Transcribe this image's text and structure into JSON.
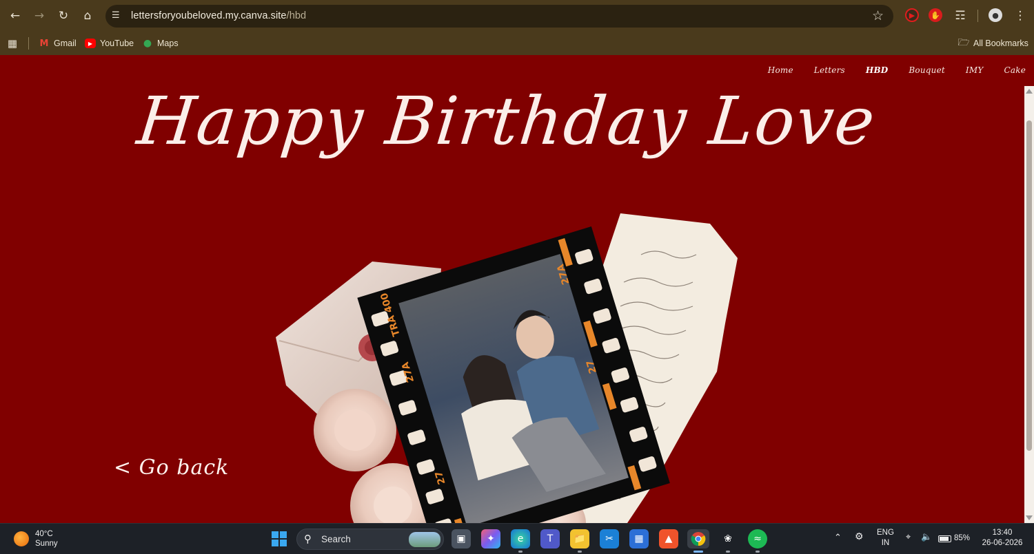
{
  "browser": {
    "url_host": "lettersforyoubeloved.my.canva.site",
    "url_path": "/hbd",
    "bookmarks": [
      {
        "label": "Gmail",
        "icon": "gmail-icon"
      },
      {
        "label": "YouTube",
        "icon": "youtube-icon"
      },
      {
        "label": "Maps",
        "icon": "maps-icon"
      }
    ],
    "all_bookmarks": "All Bookmarks"
  },
  "site": {
    "nav": [
      "Home",
      "Letters",
      "HBD",
      "Bouquet",
      "IMY",
      "Cake"
    ],
    "active_nav": "HBD",
    "headline": "Happy Birthday Love",
    "go_back": "< Go back",
    "film": {
      "top_label": "TRA 400",
      "left_a": "27A",
      "left_num": "27",
      "right_a": "27A",
      "right_num": "27"
    },
    "background_color": "#800000"
  },
  "taskbar": {
    "temperature": "40°C",
    "condition": "Sunny",
    "search_label": "Search",
    "language_line1": "ENG",
    "language_line2": "IN",
    "battery": "85%",
    "time": "13:40",
    "date": "26-06-2026"
  }
}
